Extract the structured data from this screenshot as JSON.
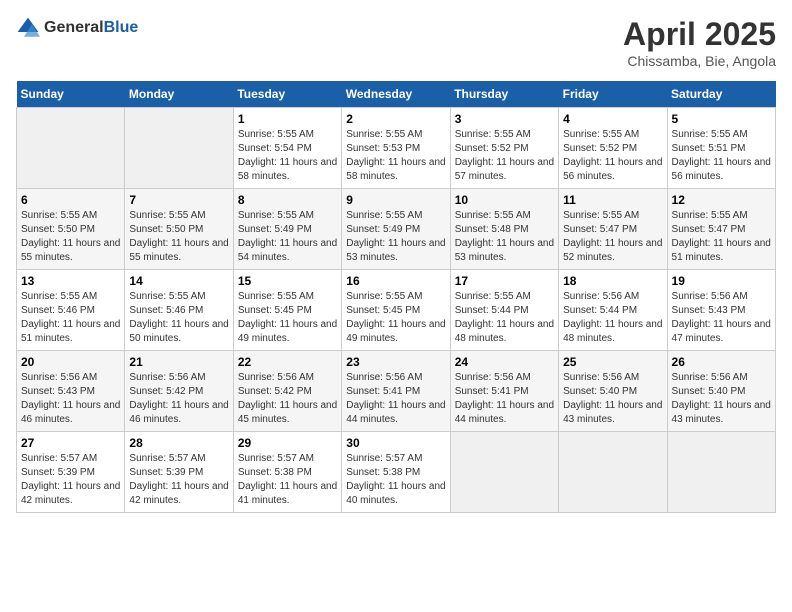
{
  "logo": {
    "general": "General",
    "blue": "Blue"
  },
  "title": "April 2025",
  "location": "Chissamba, Bie, Angola",
  "days_of_week": [
    "Sunday",
    "Monday",
    "Tuesday",
    "Wednesday",
    "Thursday",
    "Friday",
    "Saturday"
  ],
  "weeks": [
    [
      {
        "day": "",
        "empty": true
      },
      {
        "day": "",
        "empty": true
      },
      {
        "day": "1",
        "sunrise": "Sunrise: 5:55 AM",
        "sunset": "Sunset: 5:54 PM",
        "daylight": "Daylight: 11 hours and 58 minutes."
      },
      {
        "day": "2",
        "sunrise": "Sunrise: 5:55 AM",
        "sunset": "Sunset: 5:53 PM",
        "daylight": "Daylight: 11 hours and 58 minutes."
      },
      {
        "day": "3",
        "sunrise": "Sunrise: 5:55 AM",
        "sunset": "Sunset: 5:52 PM",
        "daylight": "Daylight: 11 hours and 57 minutes."
      },
      {
        "day": "4",
        "sunrise": "Sunrise: 5:55 AM",
        "sunset": "Sunset: 5:52 PM",
        "daylight": "Daylight: 11 hours and 56 minutes."
      },
      {
        "day": "5",
        "sunrise": "Sunrise: 5:55 AM",
        "sunset": "Sunset: 5:51 PM",
        "daylight": "Daylight: 11 hours and 56 minutes."
      }
    ],
    [
      {
        "day": "6",
        "sunrise": "Sunrise: 5:55 AM",
        "sunset": "Sunset: 5:50 PM",
        "daylight": "Daylight: 11 hours and 55 minutes."
      },
      {
        "day": "7",
        "sunrise": "Sunrise: 5:55 AM",
        "sunset": "Sunset: 5:50 PM",
        "daylight": "Daylight: 11 hours and 55 minutes."
      },
      {
        "day": "8",
        "sunrise": "Sunrise: 5:55 AM",
        "sunset": "Sunset: 5:49 PM",
        "daylight": "Daylight: 11 hours and 54 minutes."
      },
      {
        "day": "9",
        "sunrise": "Sunrise: 5:55 AM",
        "sunset": "Sunset: 5:49 PM",
        "daylight": "Daylight: 11 hours and 53 minutes."
      },
      {
        "day": "10",
        "sunrise": "Sunrise: 5:55 AM",
        "sunset": "Sunset: 5:48 PM",
        "daylight": "Daylight: 11 hours and 53 minutes."
      },
      {
        "day": "11",
        "sunrise": "Sunrise: 5:55 AM",
        "sunset": "Sunset: 5:47 PM",
        "daylight": "Daylight: 11 hours and 52 minutes."
      },
      {
        "day": "12",
        "sunrise": "Sunrise: 5:55 AM",
        "sunset": "Sunset: 5:47 PM",
        "daylight": "Daylight: 11 hours and 51 minutes."
      }
    ],
    [
      {
        "day": "13",
        "sunrise": "Sunrise: 5:55 AM",
        "sunset": "Sunset: 5:46 PM",
        "daylight": "Daylight: 11 hours and 51 minutes."
      },
      {
        "day": "14",
        "sunrise": "Sunrise: 5:55 AM",
        "sunset": "Sunset: 5:46 PM",
        "daylight": "Daylight: 11 hours and 50 minutes."
      },
      {
        "day": "15",
        "sunrise": "Sunrise: 5:55 AM",
        "sunset": "Sunset: 5:45 PM",
        "daylight": "Daylight: 11 hours and 49 minutes."
      },
      {
        "day": "16",
        "sunrise": "Sunrise: 5:55 AM",
        "sunset": "Sunset: 5:45 PM",
        "daylight": "Daylight: 11 hours and 49 minutes."
      },
      {
        "day": "17",
        "sunrise": "Sunrise: 5:55 AM",
        "sunset": "Sunset: 5:44 PM",
        "daylight": "Daylight: 11 hours and 48 minutes."
      },
      {
        "day": "18",
        "sunrise": "Sunrise: 5:56 AM",
        "sunset": "Sunset: 5:44 PM",
        "daylight": "Daylight: 11 hours and 48 minutes."
      },
      {
        "day": "19",
        "sunrise": "Sunrise: 5:56 AM",
        "sunset": "Sunset: 5:43 PM",
        "daylight": "Daylight: 11 hours and 47 minutes."
      }
    ],
    [
      {
        "day": "20",
        "sunrise": "Sunrise: 5:56 AM",
        "sunset": "Sunset: 5:43 PM",
        "daylight": "Daylight: 11 hours and 46 minutes."
      },
      {
        "day": "21",
        "sunrise": "Sunrise: 5:56 AM",
        "sunset": "Sunset: 5:42 PM",
        "daylight": "Daylight: 11 hours and 46 minutes."
      },
      {
        "day": "22",
        "sunrise": "Sunrise: 5:56 AM",
        "sunset": "Sunset: 5:42 PM",
        "daylight": "Daylight: 11 hours and 45 minutes."
      },
      {
        "day": "23",
        "sunrise": "Sunrise: 5:56 AM",
        "sunset": "Sunset: 5:41 PM",
        "daylight": "Daylight: 11 hours and 44 minutes."
      },
      {
        "day": "24",
        "sunrise": "Sunrise: 5:56 AM",
        "sunset": "Sunset: 5:41 PM",
        "daylight": "Daylight: 11 hours and 44 minutes."
      },
      {
        "day": "25",
        "sunrise": "Sunrise: 5:56 AM",
        "sunset": "Sunset: 5:40 PM",
        "daylight": "Daylight: 11 hours and 43 minutes."
      },
      {
        "day": "26",
        "sunrise": "Sunrise: 5:56 AM",
        "sunset": "Sunset: 5:40 PM",
        "daylight": "Daylight: 11 hours and 43 minutes."
      }
    ],
    [
      {
        "day": "27",
        "sunrise": "Sunrise: 5:57 AM",
        "sunset": "Sunset: 5:39 PM",
        "daylight": "Daylight: 11 hours and 42 minutes."
      },
      {
        "day": "28",
        "sunrise": "Sunrise: 5:57 AM",
        "sunset": "Sunset: 5:39 PM",
        "daylight": "Daylight: 11 hours and 42 minutes."
      },
      {
        "day": "29",
        "sunrise": "Sunrise: 5:57 AM",
        "sunset": "Sunset: 5:38 PM",
        "daylight": "Daylight: 11 hours and 41 minutes."
      },
      {
        "day": "30",
        "sunrise": "Sunrise: 5:57 AM",
        "sunset": "Sunset: 5:38 PM",
        "daylight": "Daylight: 11 hours and 40 minutes."
      },
      {
        "day": "",
        "empty": true
      },
      {
        "day": "",
        "empty": true
      },
      {
        "day": "",
        "empty": true
      }
    ]
  ]
}
